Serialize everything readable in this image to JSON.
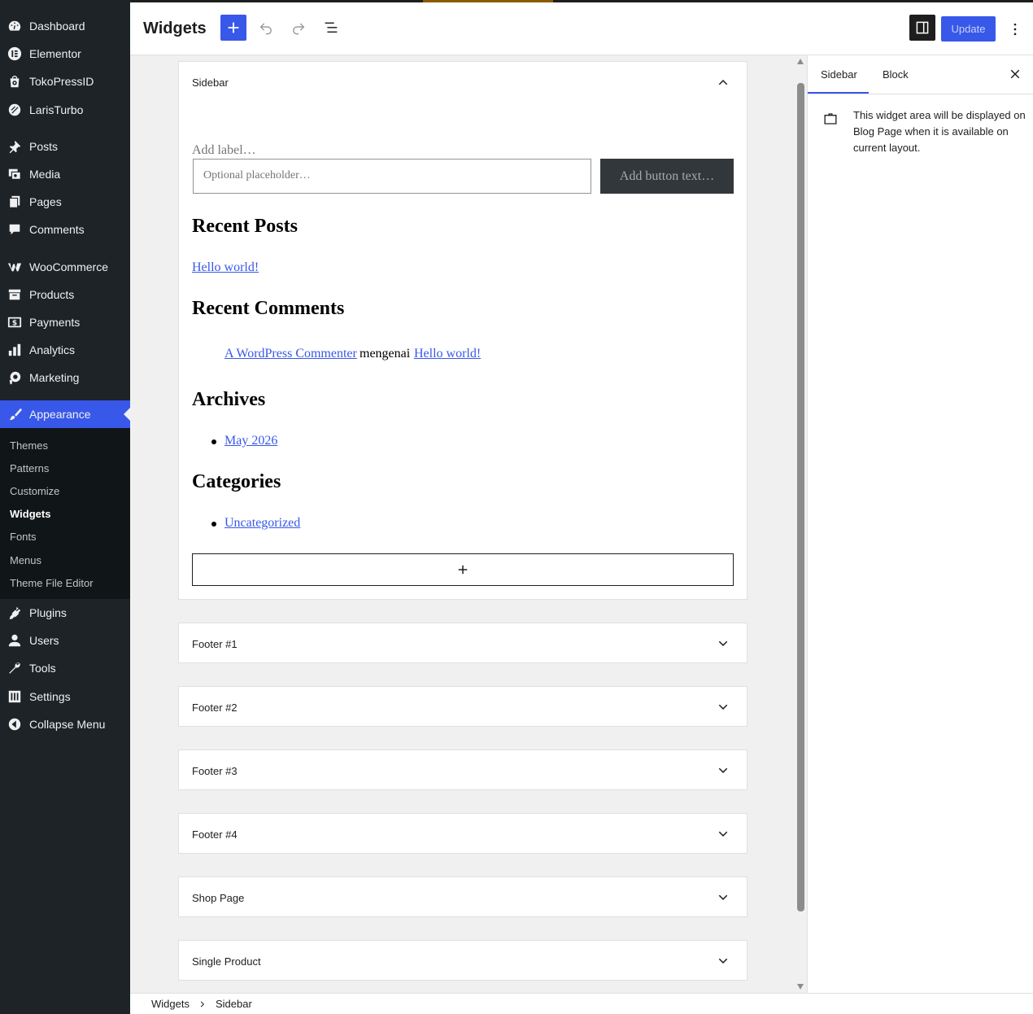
{
  "admin_menu": {
    "items": [
      {
        "label": "Dashboard",
        "icon": "dashboard-icon"
      },
      {
        "label": "Elementor",
        "icon": "elementor-icon"
      },
      {
        "label": "TokoPressID",
        "icon": "tokopress-icon"
      },
      {
        "label": "LarisTurbo",
        "icon": "laristurbo-icon"
      },
      {
        "label": "Posts",
        "icon": "pin-icon"
      },
      {
        "label": "Media",
        "icon": "media-icon"
      },
      {
        "label": "Pages",
        "icon": "pages-icon"
      },
      {
        "label": "Comments",
        "icon": "comment-icon"
      },
      {
        "label": "WooCommerce",
        "icon": "woocommerce-icon"
      },
      {
        "label": "Products",
        "icon": "archive-icon"
      },
      {
        "label": "Payments",
        "icon": "dollar-icon"
      },
      {
        "label": "Analytics",
        "icon": "chart-icon"
      },
      {
        "label": "Marketing",
        "icon": "megaphone-icon"
      },
      {
        "label": "Appearance",
        "icon": "brush-icon"
      },
      {
        "label": "Plugins",
        "icon": "plug-icon"
      },
      {
        "label": "Users",
        "icon": "user-icon"
      },
      {
        "label": "Tools",
        "icon": "wrench-icon"
      },
      {
        "label": "Settings",
        "icon": "settings-icon"
      },
      {
        "label": "Collapse Menu",
        "icon": "collapse-icon"
      }
    ],
    "submenu": [
      "Themes",
      "Patterns",
      "Customize",
      "Widgets",
      "Fonts",
      "Menus",
      "Theme File Editor"
    ]
  },
  "toolbar": {
    "title": "Widgets",
    "update_label": "Update"
  },
  "sidebar_panel": {
    "title": "Sidebar",
    "search_label": "Add label…",
    "search_placeholder": "Optional placeholder…",
    "search_button": "Add button text…",
    "recent_posts_heading": "Recent Posts",
    "recent_post_link": "Hello world!",
    "recent_comments_heading": "Recent Comments",
    "comment_author": "A WordPress Commenter",
    "comment_on": "mengenai",
    "comment_post": "Hello world!",
    "archives_heading": "Archives",
    "archive_link": "May 2026",
    "categories_heading": "Categories",
    "category_link": "Uncategorized"
  },
  "collapsed_panels": [
    "Footer #1",
    "Footer #2",
    "Footer #3",
    "Footer #4",
    "Shop Page",
    "Single Product"
  ],
  "settings": {
    "tab_sidebar": "Sidebar",
    "tab_block": "Block",
    "description": "This widget area will be displayed on Blog Page when it is available on current layout."
  },
  "breadcrumb": {
    "root": "Widgets",
    "current": "Sidebar"
  },
  "colors": {
    "accent": "#3858e9",
    "admin_bg": "#1d2327",
    "submenu_bg": "#101517"
  }
}
